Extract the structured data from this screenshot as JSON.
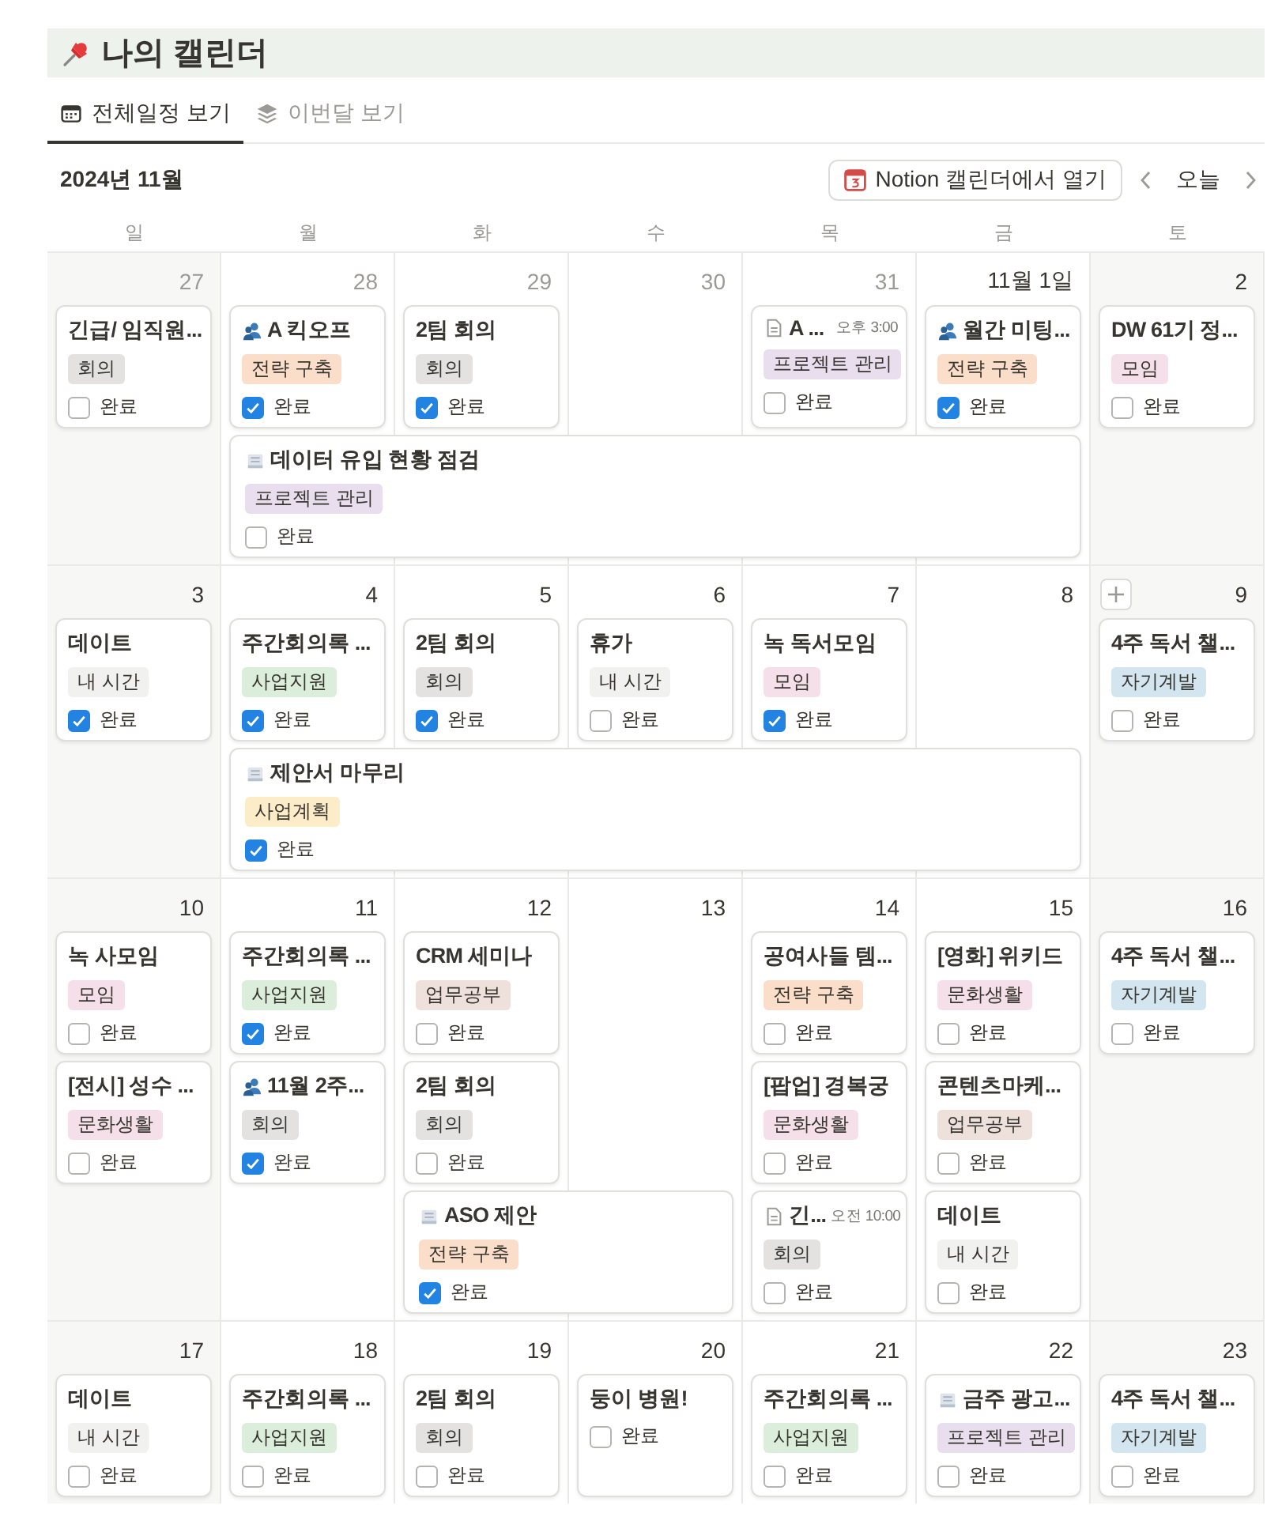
{
  "title": "나의 캘린더",
  "tabs": [
    {
      "label": "전체일정 보기",
      "kind": "calendar",
      "selected": true
    },
    {
      "label": "이번달 보기",
      "kind": "layers",
      "selected": false
    }
  ],
  "toolbar": {
    "month": "2024년 11월",
    "open_button": "Notion 캘린더에서 열기",
    "today_button": "오늘"
  },
  "weekdays": [
    "일",
    "월",
    "화",
    "수",
    "목",
    "금",
    "토"
  ],
  "weeks": [
    {
      "days": [
        {
          "date": "27",
          "outside": true,
          "hover": false,
          "events": [
            {
              "kind": "plain",
              "multi_day": false,
              "title": "긴급/ 임직원...",
              "tag": {
                "label": "회의",
                "color": "#e3e2e0"
              },
              "check_label": "완료",
              "done": false
            }
          ]
        },
        {
          "date": "28",
          "outside": true,
          "hover": false,
          "events": [
            {
              "kind": "people",
              "multi_day": false,
              "title": "A 킥오프",
              "tag": {
                "label": "전략 구축",
                "color": "#fadec9"
              },
              "check_label": "완료",
              "done": true
            },
            {
              "kind": "memo",
              "multi_day": true,
              "title": "데이터 유입 현황 점검",
              "tag": {
                "label": "프로젝트 관리",
                "color": "#e8deee"
              },
              "check_label": "완료",
              "done": false
            }
          ]
        },
        {
          "date": "29",
          "outside": true,
          "hover": false,
          "events": [
            {
              "kind": "plain",
              "multi_day": false,
              "title": "2팀 회의",
              "tag": {
                "label": "회의",
                "color": "#e3e2e0"
              },
              "check_label": "완료",
              "done": true
            },
            {
              "kind": "continued"
            }
          ]
        },
        {
          "date": "30",
          "outside": true,
          "hover": false,
          "events": [
            {
              "kind": "continued"
            }
          ]
        },
        {
          "date": "31",
          "outside": true,
          "hover": false,
          "events": [
            {
              "kind": "document",
              "multi_day": false,
              "title": "A ...",
              "time": "오후 3:00",
              "tag": {
                "label": "프로젝트 관리",
                "color": "#e8deee"
              },
              "check_label": "완료",
              "done": false
            },
            {
              "kind": "continued"
            }
          ]
        },
        {
          "date": "11월 1일",
          "outside": false,
          "hover": false,
          "events": [
            {
              "kind": "people",
              "multi_day": false,
              "title": "월간 미팅...",
              "tag": {
                "label": "전략 구축",
                "color": "#fadec9"
              },
              "check_label": "완료",
              "done": true
            },
            {
              "kind": "continued"
            }
          ]
        },
        {
          "date": "2",
          "outside": false,
          "hover": false,
          "events": [
            {
              "kind": "plain",
              "multi_day": false,
              "title": "DW 61기 정...",
              "tag": {
                "label": "모임",
                "color": "#f5e0e9"
              },
              "check_label": "완료",
              "done": false
            }
          ]
        }
      ]
    },
    {
      "days": [
        {
          "date": "3",
          "outside": false,
          "hover": false,
          "events": [
            {
              "kind": "plain",
              "multi_day": false,
              "title": "데이트",
              "tag": {
                "label": "내 시간",
                "color": "#f1f1ef"
              },
              "check_label": "완료",
              "done": true
            }
          ]
        },
        {
          "date": "4",
          "outside": false,
          "hover": false,
          "events": [
            {
              "kind": "plain",
              "multi_day": false,
              "title": "주간회의록 ...",
              "tag": {
                "label": "사업지원",
                "color": "#dbeddb"
              },
              "check_label": "완료",
              "done": true
            },
            {
              "kind": "memo",
              "multi_day": true,
              "title": "제안서 마무리",
              "tag": {
                "label": "사업계획",
                "color": "#fdecc8"
              },
              "check_label": "완료",
              "done": true
            }
          ]
        },
        {
          "date": "5",
          "outside": false,
          "hover": false,
          "events": [
            {
              "kind": "plain",
              "multi_day": false,
              "title": "2팀 회의",
              "tag": {
                "label": "회의",
                "color": "#e3e2e0"
              },
              "check_label": "완료",
              "done": true
            },
            {
              "kind": "continued"
            }
          ]
        },
        {
          "date": "6",
          "outside": false,
          "hover": false,
          "events": [
            {
              "kind": "plain",
              "multi_day": false,
              "title": "휴가",
              "tag": {
                "label": "내 시간",
                "color": "#f1f1ef"
              },
              "check_label": "완료",
              "done": false
            },
            {
              "kind": "continued"
            }
          ]
        },
        {
          "date": "7",
          "outside": false,
          "hover": false,
          "events": [
            {
              "kind": "plain",
              "multi_day": false,
              "title": "녹 독서모임",
              "tag": {
                "label": "모임",
                "color": "#f5e0e9"
              },
              "check_label": "완료",
              "done": true
            },
            {
              "kind": "continued"
            }
          ]
        },
        {
          "date": "8",
          "outside": false,
          "hover": false,
          "events": [
            {
              "kind": "continued"
            }
          ]
        },
        {
          "date": "9",
          "outside": false,
          "hover": true,
          "events": [
            {
              "kind": "plain",
              "multi_day": false,
              "title": "4주 독서 챌...",
              "tag": {
                "label": "자기계발",
                "color": "#d3e5ef"
              },
              "check_label": "완료",
              "done": false
            }
          ]
        }
      ]
    },
    {
      "days": [
        {
          "date": "10",
          "outside": false,
          "hover": false,
          "events": [
            {
              "kind": "plain",
              "multi_day": false,
              "title": "녹 사모임",
              "tag": {
                "label": "모임",
                "color": "#f5e0e9"
              },
              "check_label": "완료",
              "done": false
            },
            {
              "kind": "plain",
              "multi_day": false,
              "title": "[전시] 성수 ...",
              "tag": {
                "label": "문화생활",
                "color": "#f5e0e9"
              },
              "check_label": "완료",
              "done": false
            }
          ]
        },
        {
          "date": "11",
          "outside": false,
          "hover": false,
          "events": [
            {
              "kind": "plain",
              "multi_day": false,
              "title": "주간회의록 ...",
              "tag": {
                "label": "사업지원",
                "color": "#dbeddb"
              },
              "check_label": "완료",
              "done": true
            },
            {
              "kind": "people",
              "multi_day": false,
              "title": "11월 2주...",
              "tag": {
                "label": "회의",
                "color": "#e3e2e0"
              },
              "check_label": "완료",
              "done": true
            }
          ]
        },
        {
          "date": "12",
          "outside": false,
          "hover": false,
          "events": [
            {
              "kind": "plain",
              "multi_day": false,
              "title": "CRM 세미나",
              "tag": {
                "label": "업무공부",
                "color": "#eee0da"
              },
              "check_label": "완료",
              "done": false
            },
            {
              "kind": "plain",
              "multi_day": false,
              "title": "2팀 회의",
              "tag": {
                "label": "회의",
                "color": "#e3e2e0"
              },
              "check_label": "완료",
              "done": false
            },
            {
              "kind": "memo",
              "multi_day": true,
              "title": "ASO 제안",
              "tag": {
                "label": "전략 구축",
                "color": "#fadec9"
              },
              "check_label": "완료",
              "done": true
            }
          ]
        },
        {
          "date": "13",
          "outside": false,
          "hover": false,
          "events": [
            {
              "kind": "continued"
            }
          ]
        },
        {
          "date": "14",
          "outside": false,
          "hover": false,
          "events": [
            {
              "kind": "plain",
              "multi_day": false,
              "title": "공여사들 템...",
              "tag": {
                "label": "전략 구축",
                "color": "#fadec9"
              },
              "check_label": "완료",
              "done": false
            },
            {
              "kind": "plain",
              "multi_day": false,
              "title": "[팝업] 경복궁",
              "tag": {
                "label": "문화생활",
                "color": "#f5e0e9"
              },
              "check_label": "완료",
              "done": false
            },
            {
              "kind": "document",
              "multi_day": false,
              "title": "긴...",
              "time": "오전 10:00",
              "tag": {
                "label": "회의",
                "color": "#e3e2e0"
              },
              "check_label": "완료",
              "done": false
            }
          ]
        },
        {
          "date": "15",
          "outside": false,
          "hover": false,
          "events": [
            {
              "kind": "plain",
              "multi_day": false,
              "title": "[영화] 위키드",
              "tag": {
                "label": "문화생활",
                "color": "#f5e0e9"
              },
              "check_label": "완료",
              "done": false
            },
            {
              "kind": "plain",
              "multi_day": false,
              "title": "콘텐츠마케...",
              "tag": {
                "label": "업무공부",
                "color": "#eee0da"
              },
              "check_label": "완료",
              "done": false
            },
            {
              "kind": "plain",
              "multi_day": false,
              "title": "데이트",
              "tag": {
                "label": "내 시간",
                "color": "#f1f1ef"
              },
              "check_label": "완료",
              "done": false
            }
          ]
        },
        {
          "date": "16",
          "outside": false,
          "hover": false,
          "events": [
            {
              "kind": "plain",
              "multi_day": false,
              "title": "4주 독서 챌...",
              "tag": {
                "label": "자기계발",
                "color": "#d3e5ef"
              },
              "check_label": "완료",
              "done": false
            }
          ]
        }
      ]
    },
    {
      "days": [
        {
          "date": "17",
          "outside": false,
          "hover": false,
          "events": [
            {
              "kind": "plain",
              "multi_day": false,
              "title": "데이트",
              "tag": {
                "label": "내 시간",
                "color": "#f1f1ef"
              },
              "check_label": "완료",
              "done": false
            }
          ]
        },
        {
          "date": "18",
          "outside": false,
          "hover": false,
          "events": [
            {
              "kind": "plain",
              "multi_day": false,
              "title": "주간회의록 ...",
              "tag": {
                "label": "사업지원",
                "color": "#dbeddb"
              },
              "check_label": "완료",
              "done": false
            }
          ]
        },
        {
          "date": "19",
          "outside": false,
          "hover": false,
          "events": [
            {
              "kind": "plain",
              "multi_day": false,
              "title": "2팀 회의",
              "tag": {
                "label": "회의",
                "color": "#e3e2e0"
              },
              "check_label": "완료",
              "done": false
            }
          ]
        },
        {
          "date": "20",
          "outside": false,
          "hover": false,
          "events": [
            {
              "kind": "plain",
              "multi_day": false,
              "title": "둥이 병원!",
              "check_label": "완료",
              "done": false
            }
          ]
        },
        {
          "date": "21",
          "outside": false,
          "hover": false,
          "events": [
            {
              "kind": "plain",
              "multi_day": false,
              "title": "주간회의록 ...",
              "tag": {
                "label": "사업지원",
                "color": "#dbeddb"
              },
              "check_label": "완료",
              "done": false
            }
          ]
        },
        {
          "date": "22",
          "outside": false,
          "hover": false,
          "events": [
            {
              "kind": "memo",
              "multi_day": false,
              "title": "금주 광고...",
              "tag": {
                "label": "프로젝트 관리",
                "color": "#e8deee"
              },
              "check_label": "완료",
              "done": false
            }
          ]
        },
        {
          "date": "23",
          "outside": false,
          "hover": false,
          "events": [
            {
              "kind": "plain",
              "multi_day": false,
              "title": "4주 독서 챌...",
              "tag": {
                "label": "자기계발",
                "color": "#d3e5ef"
              },
              "check_label": "완료",
              "done": false
            }
          ]
        }
      ]
    }
  ]
}
